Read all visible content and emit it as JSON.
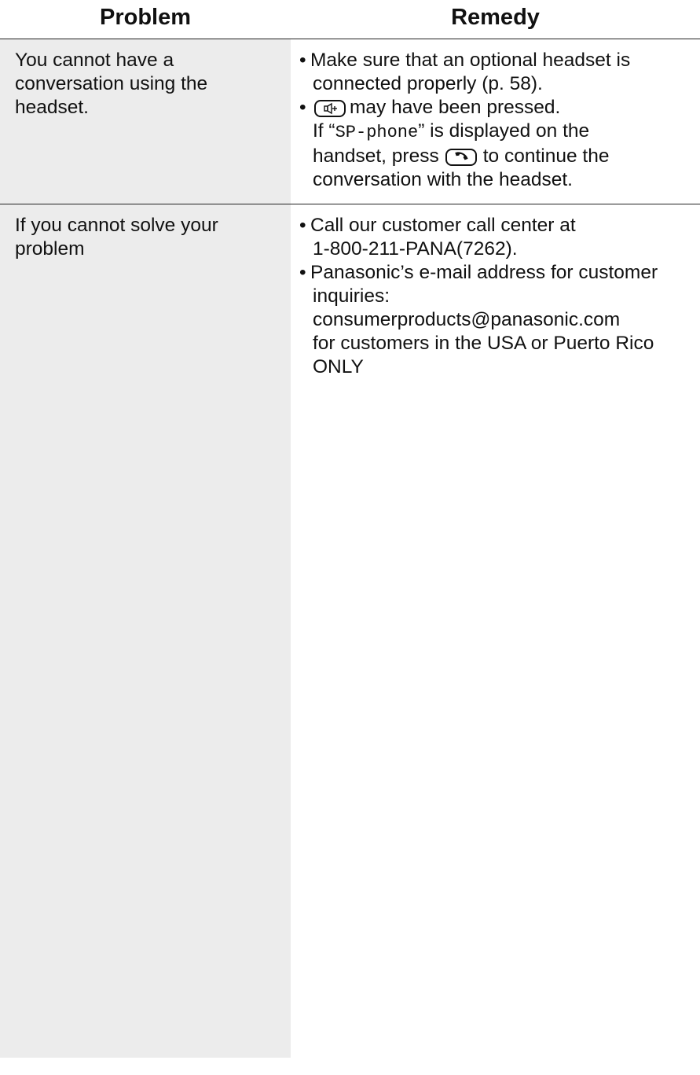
{
  "table": {
    "headers": {
      "problem": "Problem",
      "remedy": "Remedy"
    },
    "rows": [
      {
        "problem": [
          "You cannot have a",
          "conversation using the",
          "headset."
        ],
        "remedy": {
          "b1_l1": "Make sure that an optional headset is",
          "b1_l2": "connected properly (p. 58).",
          "b2_l1": "may have been pressed.",
          "b2_l2_pre": "If “",
          "b2_l2_mono": "SP-phone",
          "b2_l2_post": "” is displayed on the",
          "b2_l3_pre": "handset, press",
          "b2_l3_post": "to continue the",
          "b2_l4": "conversation with the headset.",
          "keys": [
            "speakerphone-key-icon",
            "talk-key-icon"
          ]
        }
      },
      {
        "problem": [
          "If you cannot solve your",
          "problem"
        ],
        "remedy": {
          "b1_l1": "Call our customer call center at",
          "b1_l2": "1-800-211-PANA(7262).",
          "b2_l1": "Panasonic’s e-mail address for customer",
          "b2_l2": "inquiries:",
          "b2_l3": "consumerproducts@panasonic.com",
          "b2_l4": "for customers in the USA or Puerto Rico",
          "b2_l5": "ONLY"
        }
      }
    ]
  }
}
